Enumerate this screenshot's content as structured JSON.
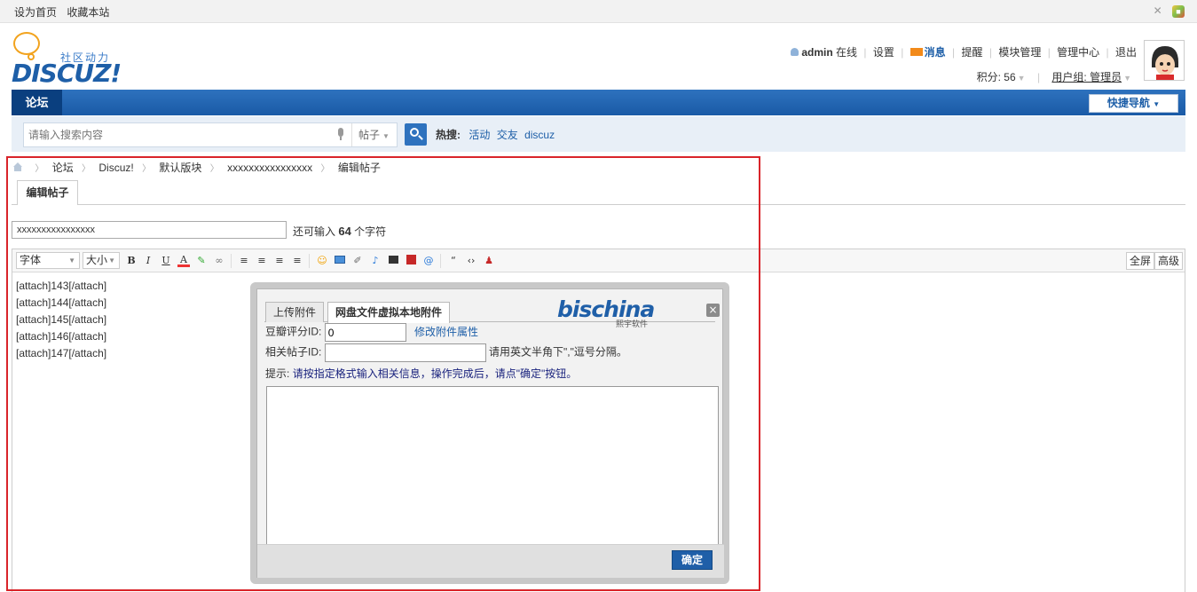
{
  "topbar": {
    "set_home": "设为首页",
    "bookmark": "收藏本站"
  },
  "logo": {
    "slogan": "社区动力",
    "brand": "DISCUZ!"
  },
  "user_nav": {
    "username": "admin",
    "status": "在线",
    "items": [
      "设置",
      "消息",
      "提醒",
      "模块管理",
      "管理中心",
      "退出"
    ]
  },
  "user_stats": {
    "credits": "积分: 56",
    "group": "用户组: 管理员"
  },
  "nav": {
    "forum_tab": "论坛",
    "quick_nav": "快捷导航"
  },
  "search": {
    "placeholder": "请输入搜索内容",
    "type": "帖子",
    "hot_label": "热搜:",
    "hot_terms": [
      "活动",
      "交友",
      "discuz"
    ]
  },
  "breadcrumb": [
    "论坛",
    "Discuz!",
    "默认版块",
    "xxxxxxxxxxxxxxxx",
    "编辑帖子"
  ],
  "edit_tab": "编辑帖子",
  "subject": {
    "value": "xxxxxxxxxxxxxxxx",
    "remain_prefix": "还可输入",
    "remain_count": "64",
    "remain_suffix": "个字符"
  },
  "toolbar": {
    "font": "字体",
    "size": "大小",
    "buttons": [
      "B",
      "I",
      "U",
      "A"
    ],
    "fullscreen": "全屏",
    "advanced": "高级"
  },
  "content_lines": [
    "[attach]143[/attach]",
    "[attach]144[/attach]",
    "[attach]145[/attach]",
    "[attach]146[/attach]",
    "[attach]147[/attach]"
  ],
  "dialog": {
    "tab_upload": "上传附件",
    "tab_netdisk": "网盘文件虚拟本地附件",
    "logo_text": "bischina",
    "logo_cn": "熙宇软件",
    "score_label": "豆瓣评分ID:",
    "score_value": "0",
    "edit_attr_link": "修改附件属性",
    "related_label": "相关帖子ID:",
    "related_value": "",
    "related_hint": "请用英文半角下\",\"逗号分隔。",
    "tip_label": "提示:",
    "tip_text": "请按指定格式输入相关信息，操作完成后，请点\"确定\"按钮。",
    "ok_button": "确定"
  }
}
